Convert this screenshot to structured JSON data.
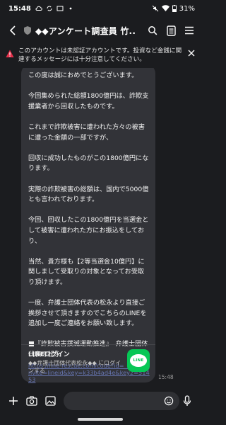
{
  "status_bar": {
    "time": "15:48",
    "battery": "31%",
    "icons": [
      "cloud-icon",
      "sync-icon",
      "cast-icon",
      "dot-icon",
      "mute-icon",
      "wifi-icon",
      "battery-icon"
    ]
  },
  "header": {
    "title": "◆◆アンケート調査員 竹...",
    "icons": [
      "back-arrow-icon",
      "shield-badge-icon",
      "search-icon",
      "notes-icon",
      "menu-icon"
    ]
  },
  "warning": {
    "text": "このアカウントは未認証アカウントです。投資など金銭に関連するメッセージには十分注意してください。",
    "icons": [
      "warning-triangle-icon",
      "close-icon"
    ]
  },
  "message": {
    "paragraphs": [
      "この度は誠におめでとうございます。",
      "今回集められた総額1800億円は、詐欺支援業者から回収したものです。",
      "これまで詐欺被害に遭われた方々の被害に遭った金額の一部ですが、",
      "回収に成功したものがこの1800億円になります。",
      "実際の詐欺被害の総額は、国内で5000億とも言われております。",
      "今回、回収したこの1800億円を当選金として被害に遭われた方にお振込をしており、",
      "当然、貴方様も【2等当選金10億円】に関しまして受取りの対象となってお受取り頂けます。",
      "一度、弁護士団体代表の松永より直接ご挨拶させて頂きますのでこちらのLINEを追加し一度ご連絡をお願い致します。",
      "■『詐欺被害撲滅運動推進』　弁護士団体代表の松永"
    ],
    "link": "https://line-rescue.com/code?id=_invite&invite=lineid&key=k33b4ad4e&key2=51453",
    "time": "15:48"
  },
  "link_card": {
    "title": "LINEログイン",
    "description": "◆◆弁護士団体代表松永◆◆ にログインする",
    "logo_text": "LINE",
    "colors": {
      "logo_bg": "#06c755"
    }
  },
  "input_bar": {
    "icons": [
      "plus-icon",
      "camera-icon",
      "image-icon",
      "emoji-icon",
      "mic-icon"
    ]
  },
  "colors": {
    "background": "#1b1c1f",
    "bubble": "#323338",
    "warning": "#e5304a",
    "link": "#6f7fc4"
  }
}
